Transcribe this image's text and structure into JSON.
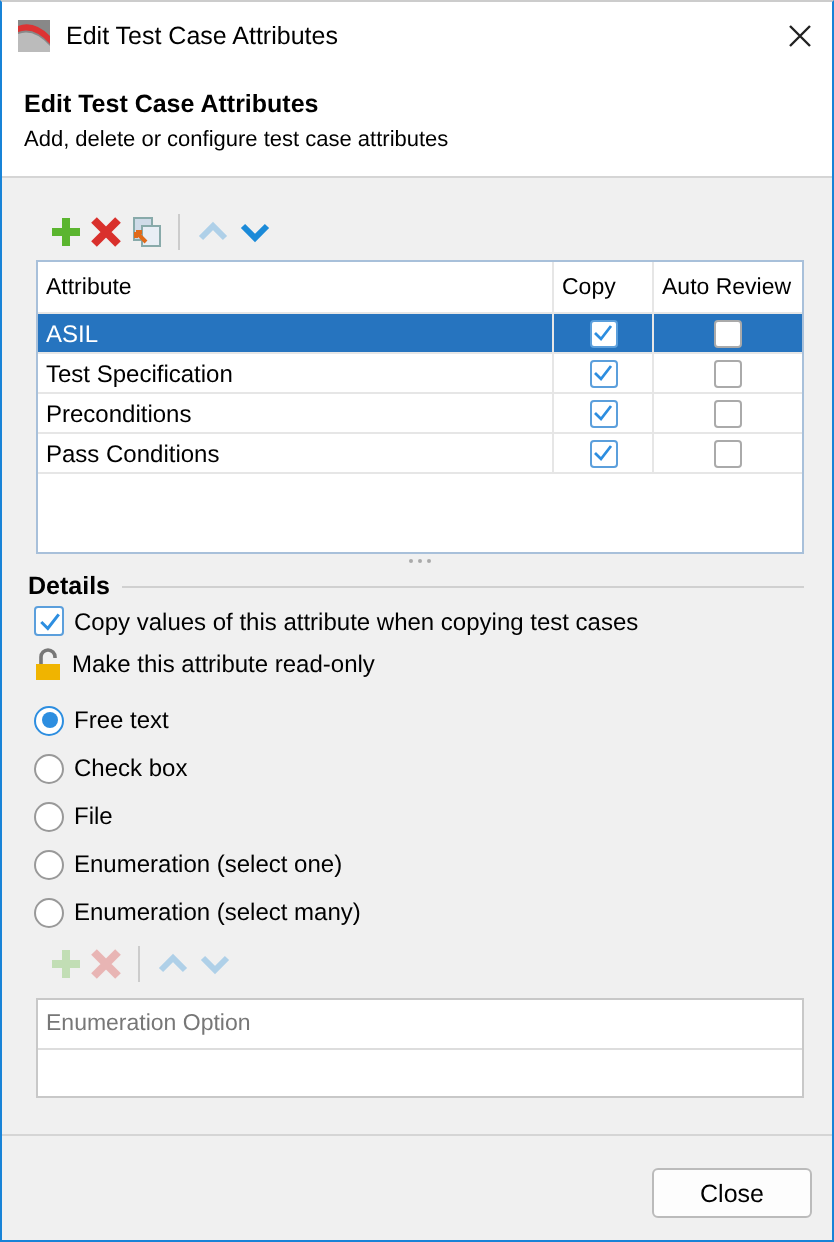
{
  "window": {
    "title": "Edit Test Case Attributes"
  },
  "header": {
    "title": "Edit Test Case Attributes",
    "subtitle": "Add, delete or configure test case attributes"
  },
  "toolbar": [
    {
      "kind": "add",
      "disabled": false
    },
    {
      "kind": "delete",
      "disabled": false
    },
    {
      "kind": "copy",
      "disabled": false
    },
    {
      "kind": "up",
      "disabled": true
    },
    {
      "kind": "down",
      "disabled": false
    }
  ],
  "table": {
    "columns": [
      "Attribute",
      "Copy",
      "Auto Review"
    ],
    "rows": [
      {
        "name": "ASIL",
        "copy": true,
        "auto_review": false,
        "selected": true
      },
      {
        "name": "Test Specification",
        "copy": true,
        "auto_review": false,
        "selected": false
      },
      {
        "name": "Preconditions",
        "copy": true,
        "auto_review": false,
        "selected": false
      },
      {
        "name": "Pass Conditions",
        "copy": true,
        "auto_review": false,
        "selected": false
      }
    ]
  },
  "details": {
    "title": "Details",
    "copy_values": {
      "label": "Copy values of this attribute when copying test cases",
      "checked": true
    },
    "read_only": {
      "label": "Make this attribute read-only",
      "locked": false
    },
    "types": [
      {
        "label": "Free text",
        "selected": true
      },
      {
        "label": "Check box",
        "selected": false
      },
      {
        "label": "File",
        "selected": false
      },
      {
        "label": "Enumeration (select one)",
        "selected": false
      },
      {
        "label": "Enumeration (select many)",
        "selected": false
      }
    ],
    "option_toolbar": [
      {
        "kind": "add",
        "disabled": true
      },
      {
        "kind": "delete",
        "disabled": true
      },
      {
        "kind": "up",
        "disabled": true
      },
      {
        "kind": "down",
        "disabled": true
      }
    ],
    "option_table": {
      "columns": [
        "Enumeration Option"
      ]
    }
  },
  "buttons": [
    "Close"
  ]
}
